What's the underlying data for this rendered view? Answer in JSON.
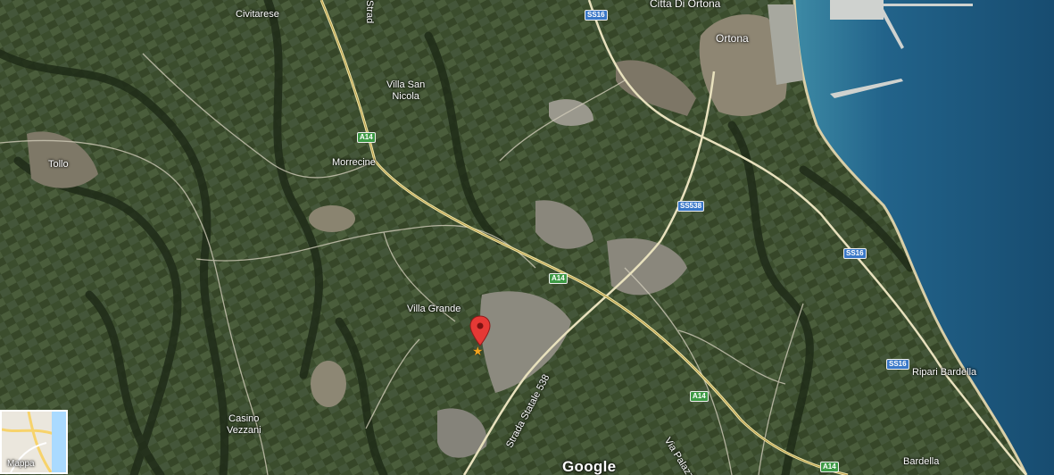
{
  "map": {
    "map_type_toggle_label": "Mappa",
    "attribution": "Google",
    "places": {
      "civitarese": "Civitarese",
      "citta_di_ortona": "Citta Di Ortona",
      "ortona": "Ortona",
      "villa_san_nicola_l1": "Villa San",
      "villa_san_nicola_l2": "Nicola",
      "tollo": "Tollo",
      "morrecine": "Morrecine",
      "villa_grande": "Villa Grande",
      "casino_vezzani_l1": "Casino",
      "casino_vezzani_l2": "Vezzani",
      "ripari_bardella": "Ripari Bardella",
      "bardella": "Bardella"
    },
    "shields": {
      "ss16_top": "SS16",
      "a14_1": "A14",
      "ss538": "SS538",
      "ss16_mid": "SS16",
      "a14_2": "A14",
      "ss16_low": "SS16",
      "a14_3": "A14",
      "a14_4": "A14"
    },
    "roads": {
      "strada_top": "Strad",
      "strada_statale": "Strada Statale 538",
      "via_palazzo": "Via Palazzo"
    },
    "colors": {
      "sea": "#1f5f86",
      "land": "#34452a",
      "highway_shield": "#3e9b46",
      "state_road_shield": "#3a78c8",
      "marker": "#e53935",
      "star": "#f3a41f"
    },
    "icons": {
      "marker": "map-pin-icon",
      "poi": "star-icon",
      "port": "port-icon"
    }
  }
}
